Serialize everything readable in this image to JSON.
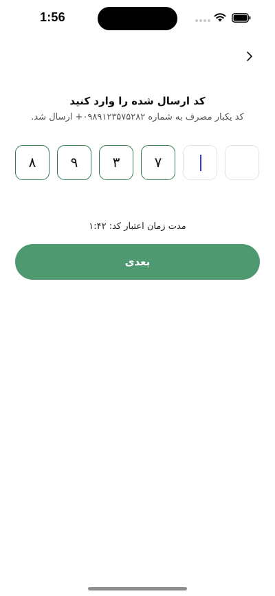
{
  "status_bar": {
    "time": "1:56"
  },
  "header": {
    "back_icon": "chevron-right-icon"
  },
  "verification": {
    "title": "کد ارسال شده را وارد کنید",
    "subtitle": "کد یکبار مصرف به شماره ۰۹۸۹۱۲۳۵۷۵۲۸۲+ ارسال شد.",
    "digits": [
      "",
      "",
      "۷",
      "۳",
      "۹",
      "۸"
    ],
    "timer_text": "مدت زمان اعتبار کد: ۱:۴۲"
  },
  "actions": {
    "next_label": "بعدی"
  },
  "colors": {
    "accent": "#4f9970",
    "box_border_filled": "#2f7d4f",
    "box_border_empty": "#e3e3e3",
    "cursor": "#2b3ee0"
  }
}
